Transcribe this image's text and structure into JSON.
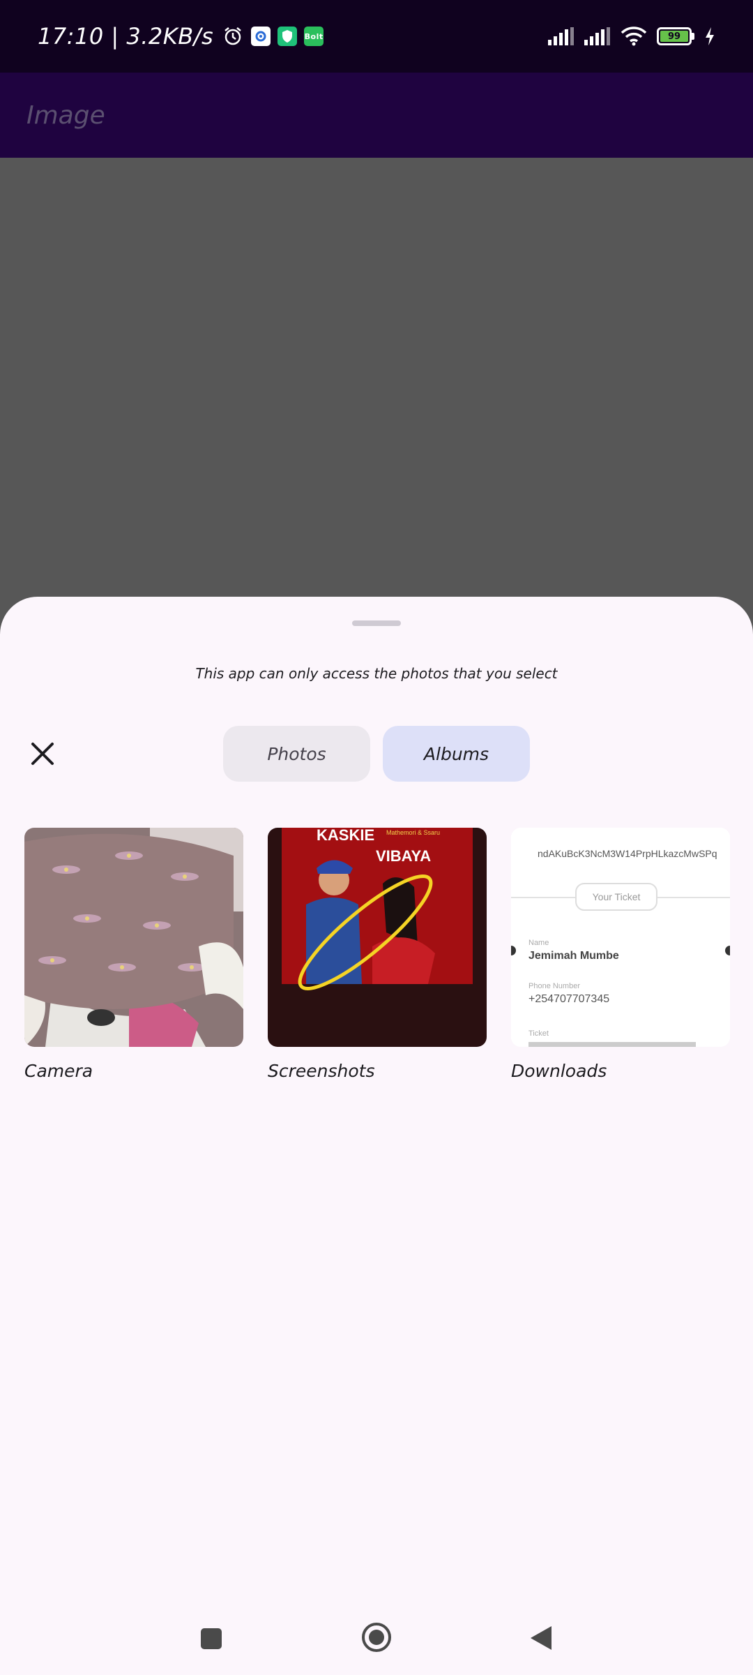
{
  "status_bar": {
    "time_speed": "17:10 | 3.2KB/s",
    "battery_level": "99",
    "app_icons": [
      "alarm-clock-icon",
      "settings-app-icon",
      "shield-app-icon",
      "bolt-app-icon"
    ],
    "bolt_label": "Bolt"
  },
  "app_bar": {
    "title": "Image"
  },
  "sheet": {
    "notice": "This app can only access the photos that you select",
    "tabs": {
      "photos": "Photos",
      "albums": "Albums"
    },
    "selected_tab": "Albums",
    "albums": [
      {
        "label": "Camera"
      },
      {
        "label": "Screenshots"
      },
      {
        "label": "Downloads"
      }
    ],
    "screenshot_preview": {
      "title": "KASKIE",
      "subtitle": "VIBAYA",
      "credit": "Mathemori & Ssaru"
    },
    "ticket_preview": {
      "code": "ndAKuBcK3NcM3W14PrpHLkazcMwSPq",
      "badge": "Your Ticket",
      "name_label": "Name",
      "name": "Jemimah Mumbe",
      "phone_label": "Phone Number",
      "phone": "+254707707345",
      "ticket_label": "Ticket"
    }
  },
  "colors": {
    "status_bar": "#10021f",
    "app_bar": "#1f0340",
    "scrim": "#575757",
    "sheet": "#fcf6fc",
    "tab_selected": "#dde0f8",
    "tab_unselected": "#ece8ee",
    "battery": "#66c24a"
  },
  "nav_bar": {
    "buttons": [
      "recents-button",
      "home-button",
      "back-button"
    ]
  }
}
